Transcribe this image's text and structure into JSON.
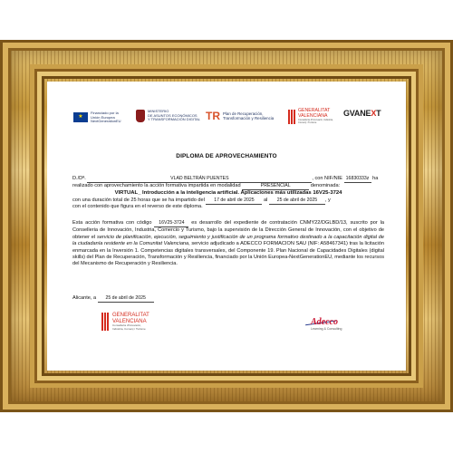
{
  "logos": {
    "eu": "Financiado por la Unión Europea",
    "eu_sub": "NextGenerationEU",
    "ministerio_1": "MINISTERIO",
    "ministerio_2": "DE ASUNTOS ECONÓMICOS",
    "ministerio_3": "Y TRANSFORMACIÓN DIGITAL",
    "plan_1": "Plan de Recuperación,",
    "plan_2": "Transformación y Resiliencia",
    "gva_1": "GENERALITAT",
    "gva_2": "VALENCIANA",
    "gva_3": "Conselleria d'Innovació, Indústria, Comerç i Turisme",
    "gvanext_a": "GVANE",
    "gvanext_b": "X",
    "gvanext_c": "T"
  },
  "title": "DIPLOMA DE APROVECHAMIENTO",
  "recipient": {
    "prefix": "D./Dª.",
    "name": "VLAD BELTRÁN PUENTES",
    "nif_label": ", con NIF/NIE",
    "nif_value": "16830333z",
    "nif_suffix": "ha"
  },
  "line2": {
    "text": "realizado con aprovechamiento la acción formativa impartida en modalidad",
    "modality": "PRESENCIAL",
    "suffix": "denominada:"
  },
  "course": "VIRTUAL_ Introducción a la inteligencia artificial. Aplicaciones más utilizadas 16V25-3724",
  "line4": {
    "a": "con una duración total de 25 horas que se ha impartido del",
    "start": "17 de abril de 2025",
    "b": "al",
    "end": "25 de abril de 2025",
    "c": ", y"
  },
  "line5": "con el contenido que figura en el reverso de este diploma.",
  "paragraph": {
    "a": "Esta acción formativa con código",
    "code": "16V25-3724",
    "b": "es desarrollo del expediente de contratación CNMY22/DGLBD/13, suscrito por la Conselleria de Innovación, Industria, Comercio y Turismo, bajo la supervisión de la Dirección General de Innovación, con el objetivo de obtener el",
    "italic": "servicio de planificación, ejecución, seguimiento y justificación de un programa formativo destinado a la capacitación digital de la ciudadanía residente en la Comunitat Valenciana",
    "c": ", servicio adjudicado a ADECCO FORMACION SAU (NIF: A58467341) tras la licitación enmarcada en la Inversión 1. Competencias digitales transversales, del Componente 19. Plan Nacional de Capacidades Digitales (digital skills) del Plan de Recuperación, Transformación y Resiliencia, financiado por la Unión Europea-NextGenerationEU, mediante los recursos del Mecanismo de Recuperación y Resiliencia."
  },
  "place_date": {
    "place": "Alicante, a",
    "date": "25 de abril de 2025"
  },
  "footer": {
    "gva_1": "GENERALITAT",
    "gva_2": "VALENCIANA",
    "gva_3": "Conselleria d'Innovació,",
    "gva_4": "Indústria, Comerç i Turisme",
    "adecco": "Adecco",
    "adecco_sub": "Learning & Consulting"
  }
}
